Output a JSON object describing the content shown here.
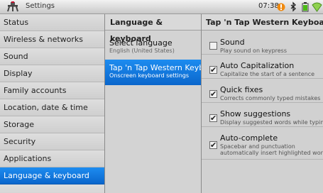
{
  "statusbar": {
    "title": "Settings",
    "time": "07:38"
  },
  "left_menu": {
    "items": [
      {
        "label": "Status"
      },
      {
        "label": "Wireless & networks"
      },
      {
        "label": "Sound"
      },
      {
        "label": "Display"
      },
      {
        "label": "Family accounts"
      },
      {
        "label": "Location, date & time"
      },
      {
        "label": "Storage"
      },
      {
        "label": "Security"
      },
      {
        "label": "Applications"
      },
      {
        "label": "Language & keyboard",
        "selected": true
      }
    ]
  },
  "middle": {
    "header": "Language & keyboard",
    "items": [
      {
        "title": "Select language",
        "subtitle": "English (United States)"
      },
      {
        "title": "Tap 'n Tap Western Keyboard",
        "subtitle": "Onscreen keyboard settings",
        "selected": true
      }
    ]
  },
  "right": {
    "header": "Tap 'n Tap Western Keyboard",
    "options": [
      {
        "title": "Sound",
        "lines": [
          "Play sound on keypress"
        ],
        "checked": false
      },
      {
        "title": "Auto Capitalization",
        "lines": [
          "Capitalize the start of a sentence"
        ],
        "checked": true
      },
      {
        "title": "Quick fixes",
        "lines": [
          "Corrects commonly typed mistakes"
        ],
        "checked": true
      },
      {
        "title": "Show suggestions",
        "lines": [
          "Display suggested words while typing"
        ],
        "checked": true
      },
      {
        "title": "Auto-complete",
        "lines": [
          "Spacebar and punctuation",
          "automatically insert highlighted word"
        ],
        "checked": true
      }
    ]
  },
  "colors": {
    "accent": "#0a74e0",
    "warn": "#f08a10",
    "battery": "#4cbb17"
  }
}
